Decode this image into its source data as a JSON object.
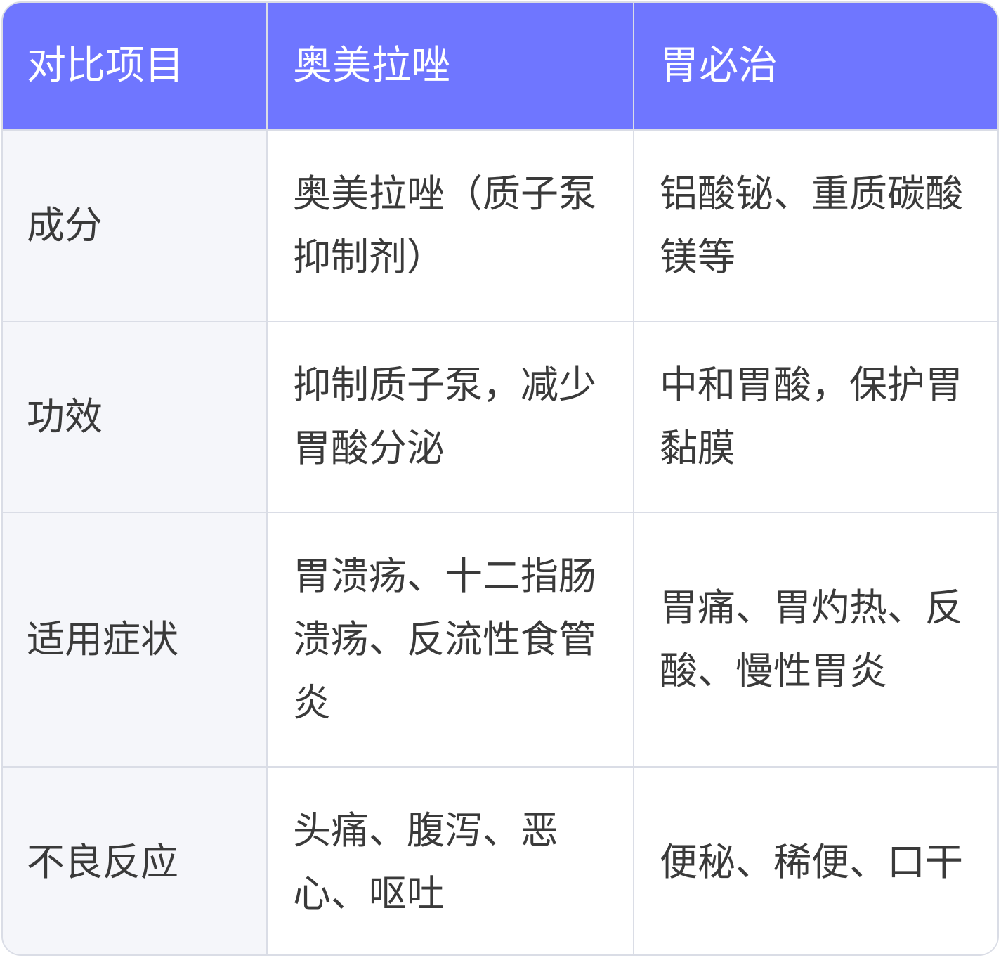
{
  "table": {
    "headers": [
      "对比项目",
      "奥美拉唑",
      "胃必治"
    ],
    "rows": [
      {
        "label": "成分",
        "omeprazole": "奥美拉唑（质子泵抑制剂）",
        "weibizhi": "铝酸铋、重质碳酸镁等"
      },
      {
        "label": "功效",
        "omeprazole": "抑制质子泵，减少胃酸分泌",
        "weibizhi": "中和胃酸，保护胃黏膜"
      },
      {
        "label": "适用症状",
        "omeprazole": "胃溃疡、十二指肠溃疡、反流性食管炎",
        "weibizhi": "胃痛、胃灼热、反酸、慢性胃炎"
      },
      {
        "label": "不良反应",
        "omeprazole": "头痛、腹泻、恶心、呕吐",
        "weibizhi": "便秘、稀便、口干"
      }
    ]
  },
  "colors": {
    "header_bg": "#6f76ff",
    "header_text": "#ffffff",
    "label_bg": "#f5f6fa",
    "border": "#dadde6",
    "body_text": "#3a3a3a"
  }
}
